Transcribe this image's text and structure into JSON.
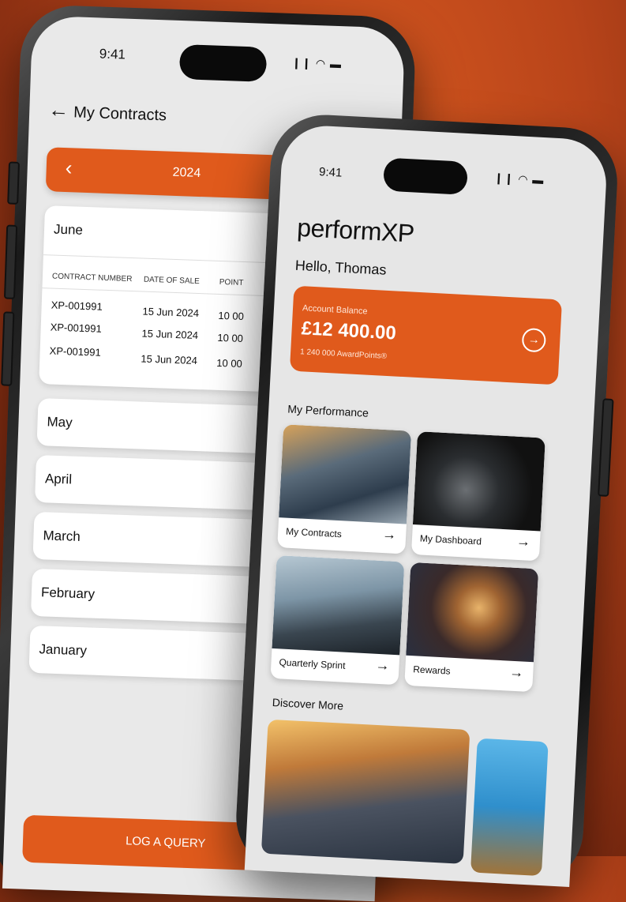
{
  "back_phone": {
    "time": "9:41",
    "status": "❙❙ ◠ ▬",
    "title": "My Contracts",
    "year": "2024",
    "june": {
      "month": "June",
      "columns": [
        "CONTRACT NUMBER",
        "DATE OF SALE",
        "POINT"
      ],
      "rows": [
        {
          "contract": "XP-001991",
          "date": "15 Jun 2024",
          "points": "10 00"
        },
        {
          "contract": "XP-001991",
          "date": "15 Jun 2024",
          "points": "10 00"
        },
        {
          "contract": "XP-001991",
          "date": "15 Jun 2024",
          "points": "10 00"
        }
      ]
    },
    "months": [
      "May",
      "April",
      "March",
      "February",
      "January"
    ],
    "log_button": "LOG A QUERY"
  },
  "front_phone": {
    "time": "9:41",
    "status": "❙❙ ◠ ▬",
    "brand": "performXP",
    "greeting": "Hello, Thomas",
    "balance": {
      "label": "Account Balance",
      "amount": "£12 400.00",
      "points": "1 240 000 AwardPoints®"
    },
    "performance_title": "My Performance",
    "tiles": [
      {
        "label": "My Contracts"
      },
      {
        "label": "My Dashboard"
      },
      {
        "label": "Quarterly Sprint"
      },
      {
        "label": "Rewards"
      }
    ],
    "discover_title": "Discover More"
  },
  "colors": {
    "accent": "#e05a1c",
    "background": "#b8441a"
  }
}
